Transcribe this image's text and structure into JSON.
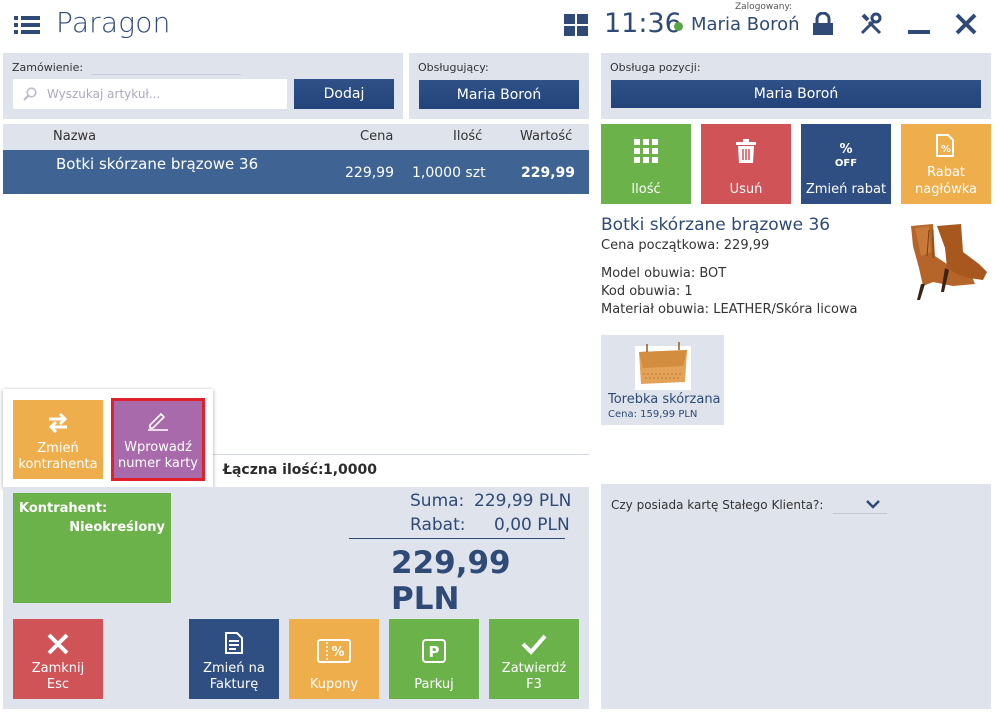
{
  "app": {
    "title": "Paragon",
    "clock": "11:36",
    "logged_label": "Zalogowany:",
    "user": "Maria Boroń"
  },
  "order": {
    "label": "Zamówienie:",
    "search_placeholder": "Wyszukaj artykuł...",
    "add_label": "Dodaj"
  },
  "staff": {
    "label": "Obsługujący:",
    "value": "Maria Boroń"
  },
  "position": {
    "label": "Obsługa pozycji:",
    "value": "Maria Boroń"
  },
  "table": {
    "headers": {
      "name": "Nazwa",
      "price": "Cena",
      "qty": "Ilość",
      "value": "Wartość"
    },
    "rows": [
      {
        "name": "Botki skórzane brązowe 36",
        "price": "229,99",
        "qty": "1,0000 szt",
        "value": "229,99"
      }
    ]
  },
  "popup": {
    "change_customer": [
      "Zmień",
      "kontrahenta"
    ],
    "enter_card": [
      "Wprowadź",
      "numer karty"
    ]
  },
  "totals": {
    "qty_label": "Łączna ilość:",
    "qty_value": "1,0000",
    "sum_label": "Suma:",
    "sum_value": "229,99 PLN",
    "discount_label": "Rabat:",
    "discount_value": "0,00 PLN",
    "total": "229,99 PLN"
  },
  "customer": {
    "label": "Kontrahent:",
    "value": "Nieokreślony"
  },
  "actions": {
    "close": [
      "Zamknij",
      "Esc"
    ],
    "invoice": [
      "Zmień na",
      "Fakturę"
    ],
    "coupons": "Kupony",
    "park": "Parkuj",
    "confirm": [
      "Zatwierdź",
      "F3"
    ]
  },
  "right_actions": {
    "qty": "Ilość",
    "remove": "Usuń",
    "discount": "Zmień rabat",
    "header_discount": [
      "Rabat",
      "nagłówka"
    ]
  },
  "product": {
    "name": "Botki skórzane brązowe 36",
    "start_price": "Cena początkowa: 229,99",
    "model": "Model obuwia: BOT",
    "code": "Kod obuwia: 1",
    "material": "Materiał obuwia: LEATHER/Skóra licowa"
  },
  "related": {
    "name": "Torebka skórzana",
    "price": "Cena: 159,99 PLN"
  },
  "loyalty": {
    "question": "Czy posiada kartę Stałego Klienta?:"
  },
  "colors": {
    "navy": "#2f4a76",
    "green": "#6bb24a",
    "red": "#d05358",
    "orange": "#eeae4b",
    "purple": "#a96aab",
    "highlight": "#e0202b"
  }
}
